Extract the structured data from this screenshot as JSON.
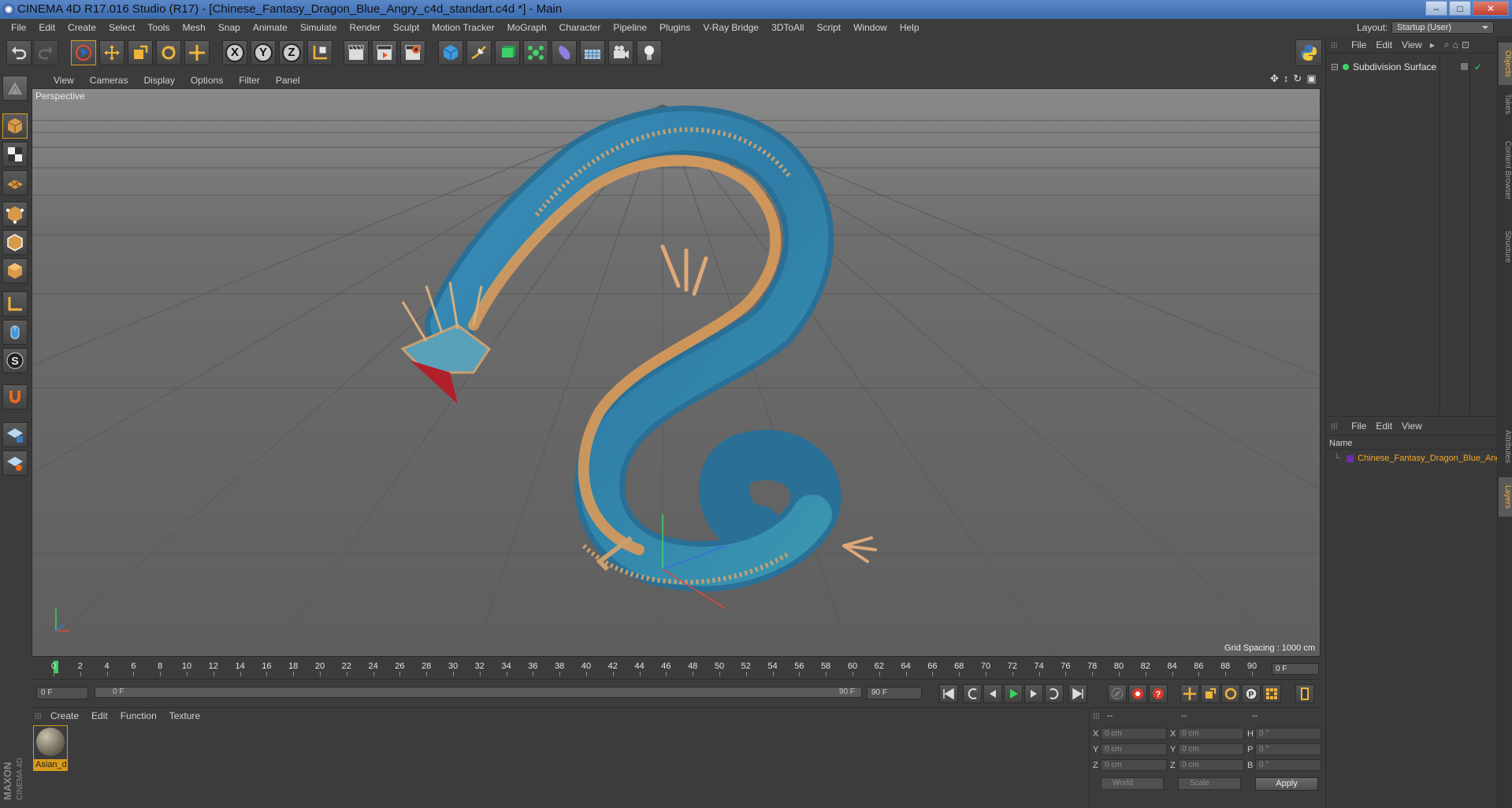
{
  "window": {
    "title": "CINEMA 4D R17.016 Studio (R17) - [Chinese_Fantasy_Dragon_Blue_Angry_c4d_standart.c4d *] - Main",
    "min": "–",
    "max": "□",
    "close": "✕"
  },
  "menu": [
    "File",
    "Edit",
    "Create",
    "Select",
    "Tools",
    "Mesh",
    "Snap",
    "Animate",
    "Simulate",
    "Render",
    "Sculpt",
    "Motion Tracker",
    "MoGraph",
    "Character",
    "Pipeline",
    "Plugins",
    "V-Ray Bridge",
    "3DToAll",
    "Script",
    "Window",
    "Help"
  ],
  "layout": {
    "label": "Layout:",
    "value": "Startup (User)"
  },
  "toolbar": {
    "x_label": "X",
    "y_label": "Y",
    "z_label": "Z"
  },
  "viewport": {
    "menu": [
      "View",
      "Cameras",
      "Display",
      "Options",
      "Filter",
      "Panel"
    ],
    "label": "Perspective",
    "grid_spacing": "Grid Spacing : 1000 cm"
  },
  "timeline": {
    "ticks": [
      "0",
      "2",
      "4",
      "6",
      "8",
      "10",
      "12",
      "14",
      "16",
      "18",
      "20",
      "22",
      "24",
      "26",
      "28",
      "30",
      "32",
      "34",
      "36",
      "38",
      "40",
      "42",
      "44",
      "46",
      "48",
      "50",
      "52",
      "54",
      "56",
      "58",
      "60",
      "62",
      "64",
      "66",
      "68",
      "70",
      "72",
      "74",
      "76",
      "78",
      "80",
      "82",
      "84",
      "86",
      "88",
      "90"
    ],
    "current_frame": "0 F",
    "start_field": "0 F",
    "slider_left": "0 F",
    "slider_right": "90 F",
    "end_field": "90 F"
  },
  "materials": {
    "menu": [
      "Create",
      "Edit",
      "Function",
      "Texture"
    ],
    "items": [
      {
        "name": "Asian_d"
      }
    ]
  },
  "coords": {
    "headers": [
      "--",
      "--",
      "--"
    ],
    "rows": [
      {
        "a": "X",
        "av": "0 cm",
        "b": "X",
        "bv": "0 cm",
        "c": "H",
        "cv": "0 °"
      },
      {
        "a": "Y",
        "av": "0 cm",
        "b": "Y",
        "bv": "0 cm",
        "c": "P",
        "cv": "0 °"
      },
      {
        "a": "Z",
        "av": "0 cm",
        "b": "Z",
        "bv": "0 cm",
        "c": "B",
        "cv": "0 °"
      }
    ],
    "world": "World",
    "scale": "Scale",
    "apply": "Apply"
  },
  "objects": {
    "menu": [
      "File",
      "Edit",
      "View"
    ],
    "items": [
      {
        "name": "Subdivision Surface"
      }
    ]
  },
  "layers": {
    "menu": [
      "File",
      "Edit",
      "View"
    ],
    "header": "Name",
    "items": [
      {
        "name": "Chinese_Fantasy_Dragon_Blue_Angry"
      }
    ]
  },
  "sidetabs": [
    "Objects",
    "Takes",
    "Content Browser",
    "Structure",
    "Attributes",
    "Layers"
  ],
  "maxon": {
    "brand": "MAXON",
    "product": "CINEMA 4D"
  },
  "colors": {
    "accent": "#d79a1a",
    "playhead": "#37d35f",
    "layer": "#f5a623"
  }
}
